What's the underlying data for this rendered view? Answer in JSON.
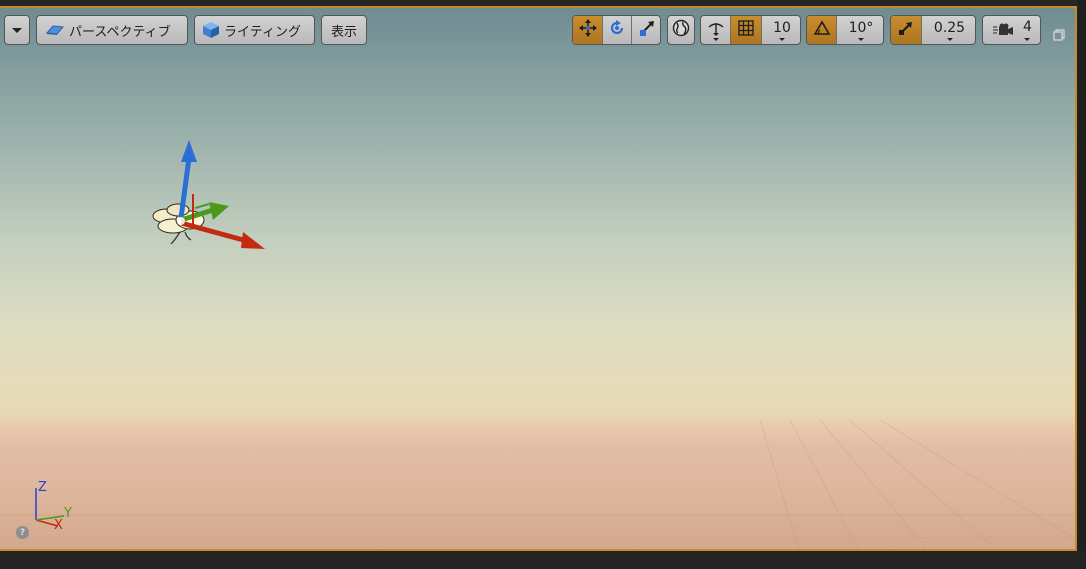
{
  "toolbar_left": {
    "perspective_label": "パースペクティブ",
    "lighting_label": "ライティング",
    "show_label": "表示"
  },
  "toolbar_right": {
    "grid_snap_value": "10",
    "rotation_snap_value": "10°",
    "scale_snap_value": "0.25",
    "camera_speed_value": "4"
  },
  "axis_indicator": {
    "z_label": "Z",
    "y_label": "Y",
    "x_label": "X"
  },
  "colors": {
    "accent": "#c48a2c",
    "x_axis": "#c42a10",
    "y_axis": "#4a9a1c",
    "z_axis": "#2a6fd6"
  }
}
